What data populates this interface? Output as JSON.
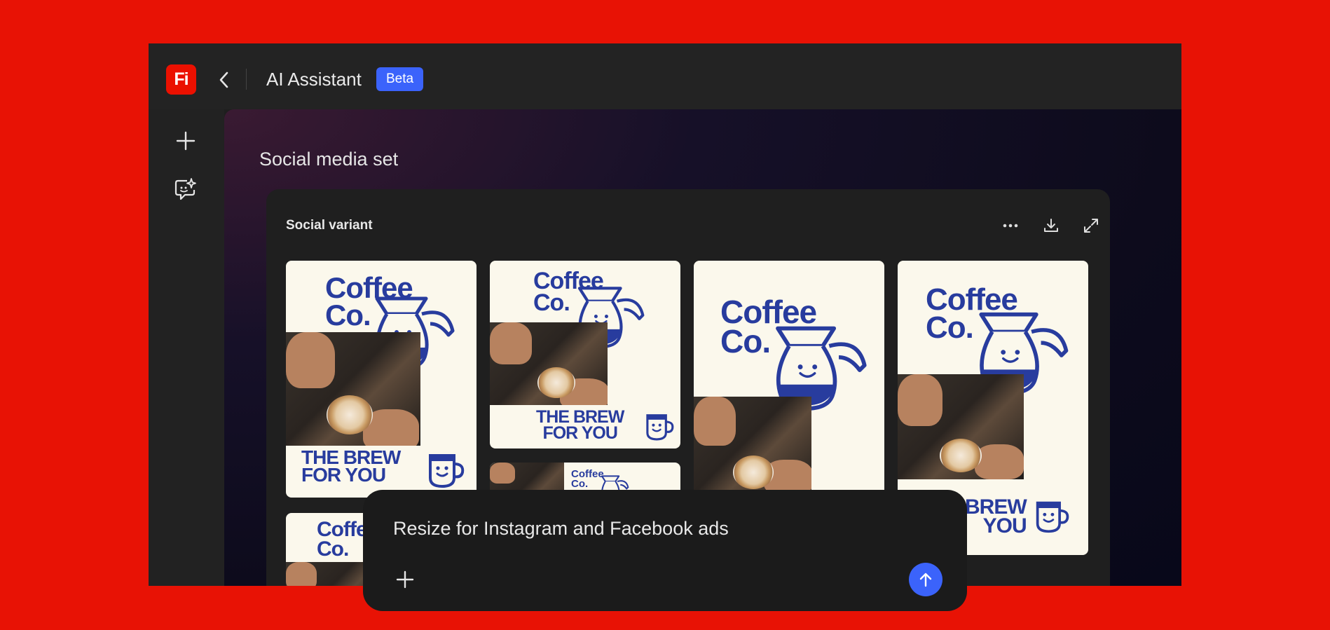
{
  "app": {
    "logo_text": "Fi",
    "title": "AI Assistant",
    "badge": "Beta"
  },
  "nav": {
    "back_icon": "chevron-left-icon",
    "rail": [
      {
        "icon": "plus-icon"
      },
      {
        "icon": "chat-sparkle-icon"
      }
    ]
  },
  "main": {
    "section_title": "Social media set",
    "card": {
      "title": "Social variant",
      "actions": [
        "more-icon",
        "download-icon",
        "expand-icon"
      ]
    }
  },
  "thumbnails": {
    "brand": "Coffee\nCo.",
    "tagline": "THE BREW\nFOR YOU",
    "tagline_partial": "BREW\nYOU"
  },
  "prompt": {
    "text": "Resize for Instagram and Facebook ads",
    "add_icon": "plus-icon",
    "send_icon": "arrow-up-icon"
  },
  "colors": {
    "background": "#e81205",
    "accent": "#3b63fb",
    "brand_blue": "#283c9e",
    "thumb_bg": "#fbf8ec"
  }
}
